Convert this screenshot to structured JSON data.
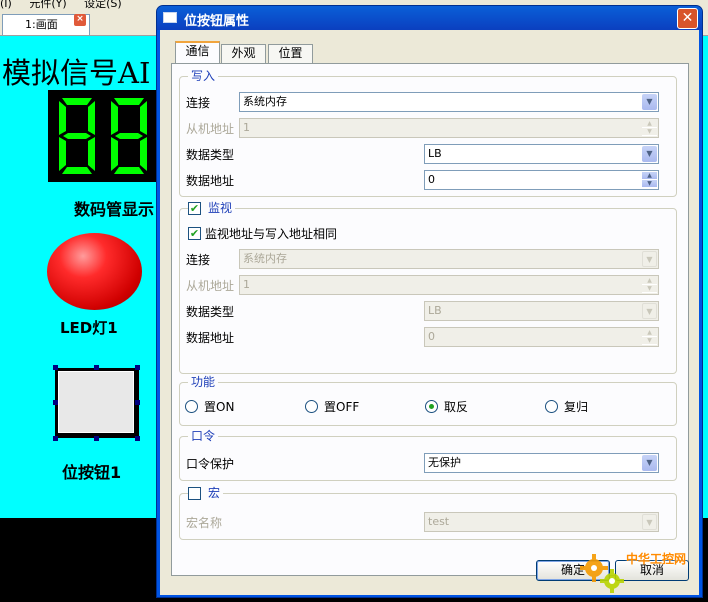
{
  "editor": {
    "menu_items": [
      "(I)",
      "元件(Y)",
      "设定(S)"
    ],
    "doc_tab_label": "1:画面",
    "doc_tab_close": "×",
    "canvas_title": "模拟信号AI",
    "seg_caption": "数码管显示",
    "led_caption": "LED灯1",
    "bit_button_caption": "位按钮1"
  },
  "dialog": {
    "title": "位按钮属性",
    "close": "✕",
    "tabs": [
      {
        "label": "通信",
        "active": true
      },
      {
        "label": "外观",
        "active": false
      },
      {
        "label": "位置",
        "active": false
      }
    ],
    "write": {
      "title": "写入",
      "connection_label": "连接",
      "connection_value": "系统内存",
      "slave_label": "从机地址",
      "slave_value": "1",
      "datatype_label": "数据类型",
      "datatype_value": "LB",
      "address_label": "数据地址",
      "address_value": "0"
    },
    "monitor": {
      "title": "监视",
      "checked": true,
      "same_addr_label": "监视地址与写入地址相同",
      "same_addr_checked": true,
      "connection_label": "连接",
      "connection_value": "系统内存",
      "slave_label": "从机地址",
      "slave_value": "1",
      "datatype_label": "数据类型",
      "datatype_value": "LB",
      "address_label": "数据地址",
      "address_value": "0"
    },
    "function": {
      "title": "功能",
      "options": [
        {
          "label": "置ON",
          "selected": false
        },
        {
          "label": "置OFF",
          "selected": false
        },
        {
          "label": "取反",
          "selected": true
        },
        {
          "label": "复归",
          "selected": false
        }
      ]
    },
    "password": {
      "title": "口令",
      "protect_label": "口令保护",
      "protect_value": "无保护"
    },
    "macro": {
      "title": "宏",
      "checked": false,
      "name_label": "宏名称",
      "name_value": "test"
    },
    "ok_label": "确定",
    "cancel_label": "取消"
  },
  "watermark_text": "中华工控网",
  "colors": {
    "canvas_bg": "#00ffff",
    "segment_on": "#00ff00",
    "led_red": "#ff2b2b",
    "group_title": "#1e3fb8",
    "titlebar": "#0054e3"
  }
}
